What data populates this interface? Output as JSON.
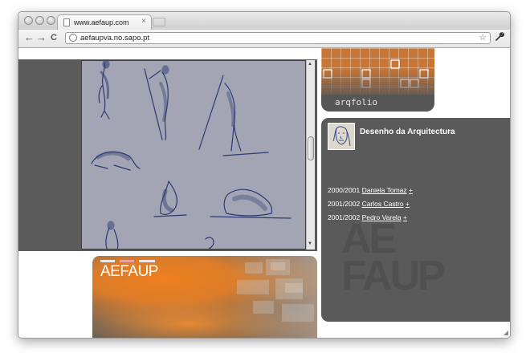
{
  "browser": {
    "tab_title": "www.aefaup.com",
    "tab_close_glyph": "×",
    "url": "aefaupva.no.sapo.pt",
    "back_glyph": "←",
    "forward_glyph": "→",
    "reload_glyph": "C",
    "star_glyph": "☆",
    "wrench_glyph": "🔧",
    "icons": [
      "back-arrow-icon",
      "forward-arrow-icon",
      "reload-icon",
      "globe-icon",
      "star-icon",
      "wrench-icon",
      "page-icon",
      "close-icon"
    ]
  },
  "page": {
    "aefaup_logo": "AEFAUP",
    "arqfolio_label": "arqfolio",
    "desenho": {
      "heading": "Desenho da Arquitectura",
      "entries": [
        {
          "year": "2000/2001",
          "name": "Daniela Tomaz",
          "plus": "+"
        },
        {
          "year": "2001/2002",
          "name": "Carlos Castro",
          "plus": "+"
        },
        {
          "year": "2001/2002",
          "name": "Pedro Varela",
          "plus": "+"
        }
      ]
    },
    "watermark_lines": [
      "AE",
      "FAUP"
    ],
    "colors": {
      "orange": "#f0801f",
      "panel_gray": "#5a5a5a",
      "drawing_bg": "#a3a5b4",
      "ink": "#2b3a73"
    }
  }
}
